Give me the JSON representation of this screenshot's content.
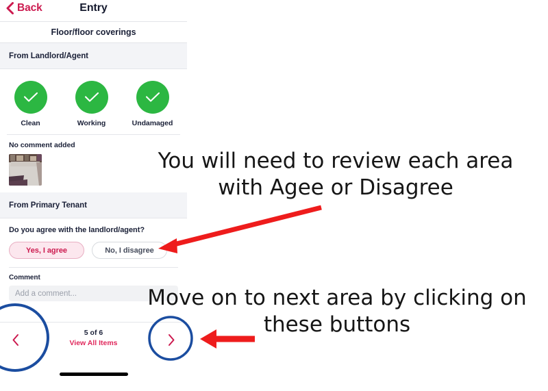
{
  "app": {
    "nav": {
      "back_label": "Back",
      "back_icon": "chevron-left-icon",
      "title": "Entry"
    },
    "subheader": {
      "title": "Floor/floor coverings"
    },
    "landlord_section": {
      "heading": "From Landlord/Agent",
      "conditions": [
        {
          "label": "Clean",
          "state": "checked",
          "icon": "check-icon"
        },
        {
          "label": "Working",
          "state": "checked",
          "icon": "check-icon"
        },
        {
          "label": "Undamaged",
          "state": "checked",
          "icon": "check-icon"
        }
      ],
      "comment_status": "No comment added",
      "photo_alt": "floor-photo-thumbnail"
    },
    "tenant_section": {
      "heading": "From Primary Tenant",
      "question": "Do you agree with the landlord/agent?",
      "choices": [
        {
          "label": "Yes, I agree",
          "selected": true
        },
        {
          "label": "No, I disagree",
          "selected": false
        }
      ]
    },
    "comment": {
      "label": "Comment",
      "value": "",
      "placeholder": "Add a comment..."
    },
    "footer": {
      "prev_icon": "chevron-left-icon",
      "next_icon": "chevron-right-icon",
      "count": "5 of 6",
      "view_all_label": "View All Items"
    },
    "colors": {
      "brand_pink": "#cc1a4f",
      "link_pink": "#e0285c",
      "success_green": "#2cb742",
      "selected_chip_bg": "#fce7ee",
      "section_band": "#f3f4f7",
      "text_dark": "#1b2138"
    }
  },
  "annotations": {
    "note_1": "You will need to review each area\nwith Agee or Disagree",
    "note_2": "Move on to next area by clicking on\nthese buttons",
    "arrow_color": "#ee1c1c",
    "circle_color": "#1b4da0",
    "highlight_circles": [
      {
        "target": "prev-page-button"
      },
      {
        "target": "next-page-button"
      }
    ]
  }
}
